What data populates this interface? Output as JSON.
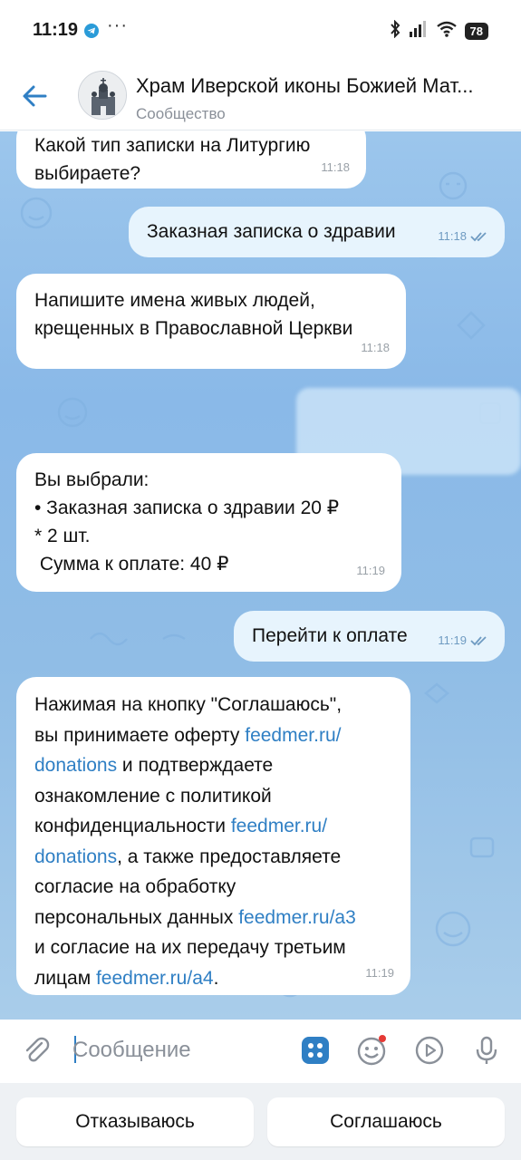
{
  "status_bar": {
    "time": "11:19",
    "more": "···",
    "battery": "78"
  },
  "header": {
    "title": "Храм Иверской иконы Божией Мат...",
    "subtitle": "Сообщество"
  },
  "messages": [
    {
      "direction": "in",
      "lines": [
        "Какой тип записки на Литургию",
        "выбираете?"
      ],
      "time": "11:18"
    },
    {
      "direction": "out",
      "text": "Заказная записка о здравии",
      "time": "11:18"
    },
    {
      "direction": "in",
      "lines": [
        "Напишите имена живых людей,",
        "крещенных в Православной Церкви"
      ],
      "time": "11:18"
    },
    {
      "direction": "in",
      "lines": [
        "Вы выбрали:",
        "•  Заказная записка о здравии 20 ₽",
        "* 2 шт.",
        " Сумма к оплате: 40 ₽"
      ],
      "time": "11:19"
    },
    {
      "direction": "out",
      "text": "Перейти к оплате",
      "time": "11:19"
    },
    {
      "direction": "in",
      "p1": "Нажимая на кнопку \"Соглашаюсь\",",
      "p2": "вы принимаете оферту ",
      "link1a": "feedmer.ru/",
      "link1b": "donations",
      "p3": " и подтверждаете",
      "p4": "ознакомление с политикой",
      "p5": "конфиденциальности ",
      "link2a": "feedmer.ru/",
      "link2b": "donations",
      "p6": ", а также предоставляете",
      "p7": "согласие на обработку",
      "p8": "персональных данных ",
      "link3": "feedmer.ru/a3",
      "p9": "и согласие на их передачу третьим",
      "p10": "лицам ",
      "link4": "feedmer.ru/a4",
      "p11": ".",
      "time": "11:19"
    }
  ],
  "input": {
    "placeholder": "Сообщение"
  },
  "keyboard": {
    "decline": "Отказываюсь",
    "accept": "Соглашаюсь"
  },
  "colors": {
    "accent": "#2f7fc4",
    "chat_bg": "#8ab9e8",
    "out_bubble": "#e7f4fd",
    "notification_dot": "#e53935"
  }
}
